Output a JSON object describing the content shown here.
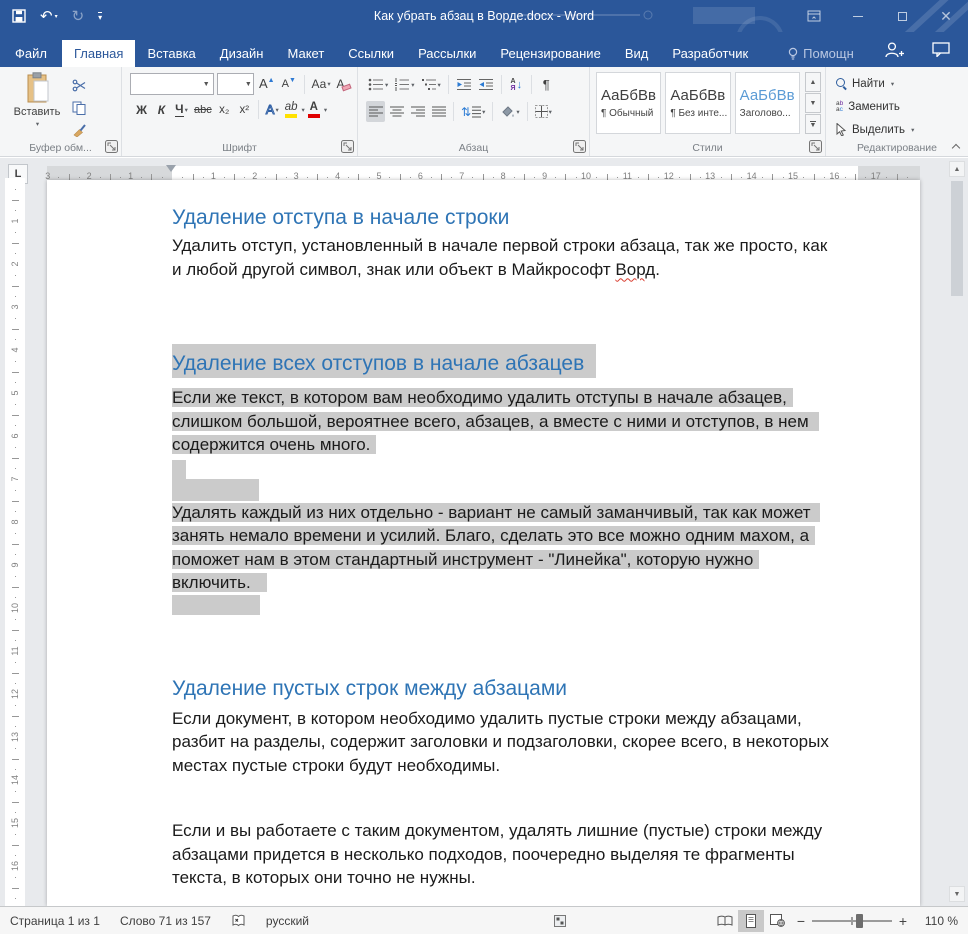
{
  "window": {
    "title": "Как убрать абзац в Ворде.docx - Word"
  },
  "tabs": [
    "Файл",
    "Главная",
    "Вставка",
    "Дизайн",
    "Макет",
    "Ссылки",
    "Рассылки",
    "Рецензирование",
    "Вид",
    "Разработчик",
    "Помощн"
  ],
  "active_tab": "Главная",
  "ribbon": {
    "clipboard": {
      "paste": "Вставить",
      "group": "Буфер обм..."
    },
    "font": {
      "group": "Шрифт",
      "bold": "Ж",
      "italic": "К",
      "underline": "Ч",
      "strike": "abc",
      "subscript": "x₂",
      "superscript": "x²",
      "grow": "А",
      "shrink": "А",
      "case": "Аа",
      "clear": "А",
      "effects": "А",
      "highlight": "ab",
      "color": "А"
    },
    "paragraph": {
      "group": "Абзац",
      "sort_top": "А",
      "sort_bottom": "Я",
      "pilcrow": "¶",
      "spacing_arrows": "⇅"
    },
    "styles": {
      "group": "Стили",
      "items": [
        {
          "preview": "АаБбВв",
          "name": "¶ Обычный"
        },
        {
          "preview": "АаБбВв",
          "name": "¶ Без инте..."
        },
        {
          "preview": "АаБбВв",
          "name": "Заголово..."
        }
      ]
    },
    "editing": {
      "group": "Редактирование",
      "find": "Найти",
      "replace": "Заменить",
      "select": "Выделить"
    }
  },
  "ruler": {
    "h_left": [
      "3",
      "2",
      "1"
    ],
    "h_right": [
      "1",
      "2",
      "3",
      "4",
      "5",
      "6",
      "7",
      "8",
      "9",
      "10",
      "11",
      "12",
      "13",
      "14",
      "15",
      "16"
    ],
    "h_outside": "17",
    "v": [
      "1",
      "2",
      "3",
      "4",
      "5",
      "6",
      "7",
      "8",
      "9",
      "10",
      "11",
      "12",
      "13",
      "14",
      "15",
      "16"
    ]
  },
  "document": {
    "h1": "Удаление отступа в начале строки",
    "p1_l1": "Удалить отступ, установленный в начале первой строки абзаца, так же просто, как",
    "p1_l2_pre": "и любой другой символ, знак или объект в Майкрософт ",
    "p1_l2_err": "Ворд",
    "p1_l2_post": ".",
    "h2": "Удаление всех отступов в начале абзацев",
    "p2": [
      "Если же текст, в котором вам необходимо удалить отступы в начале абзацев,",
      "слишком большой, вероятнее всего, абзацев, а вместе с ними и отступов, в нем",
      "содержится очень много."
    ],
    "p3": [
      "Удалять каждый из них отдельно - вариант не самый заманчивый, так как может",
      "занять немало времени и усилий. Благо, сделать это все можно одним махом, а",
      "поможет нам в этом стандартный инструмент - \"Линейка\", которую нужно",
      "включить."
    ],
    "h3": "Удаление пустых строк между абзацами",
    "p4": [
      "Если документ, в котором необходимо удалить пустые строки между абзацами,",
      "разбит на разделы, содержит заголовки и подзаголовки, скорее всего, в некоторых",
      "местах пустые строки будут необходимы."
    ],
    "p5": [
      "Если и вы работаете с таким документом, удалять лишние (пустые) строки между",
      "абзацами придется в несколько подходов, поочередно выделяя те фрагменты",
      "текста, в которых они точно не нужны."
    ]
  },
  "status": {
    "page": "Страница 1 из 1",
    "words": "Слово 71 из 157",
    "lang": "русский",
    "zoom": "110 %"
  },
  "colors": {
    "titlebar": "#2b579a",
    "active_tab_text": "#2b579a",
    "heading": "#2e74b5",
    "selection": "#cbcbcb",
    "ribbon_bg": "#f5f6f7",
    "doc_bg": "#e8eaed",
    "highlight_yellow": "#ffe100",
    "font_color_red": "#e00000"
  }
}
